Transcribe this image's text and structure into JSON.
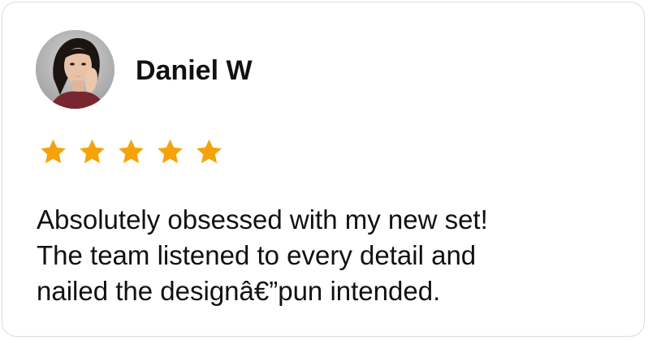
{
  "review": {
    "reviewer_name": "Daniel W",
    "rating": 5,
    "max_rating": 5,
    "star_color": "#f5a30a",
    "text_lines": [
      "Absolutely obsessed with my new set!",
      "The team listened to every detail and",
      "nailed the designâ€”pun intended."
    ]
  },
  "icons": {
    "avatar": "reviewer-photo",
    "star": "star-icon"
  }
}
